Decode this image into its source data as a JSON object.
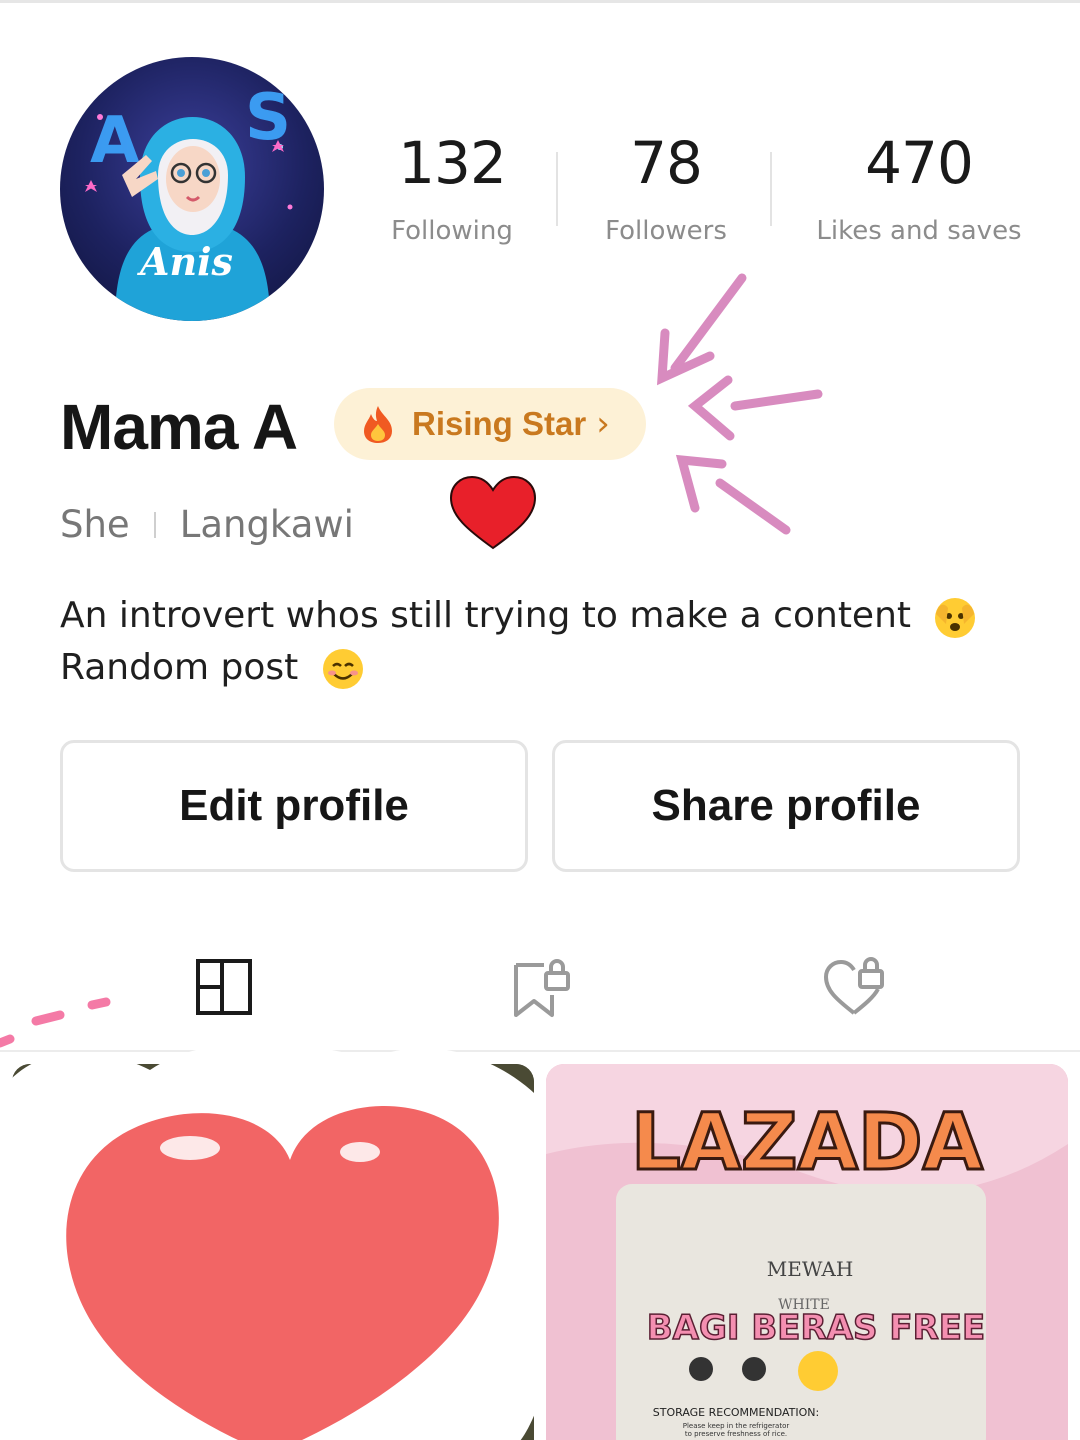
{
  "profile": {
    "name": "Mama A",
    "badge": {
      "label": "Rising Star",
      "icon": "fire-icon",
      "chevron": "›"
    },
    "pronoun": "She",
    "location": "Langkawi",
    "bio_line1": "An introvert whos still trying to make a content",
    "bio_line2": "Random post",
    "avatar_text": "Anis"
  },
  "stats": {
    "following": {
      "value": "132",
      "label": "Following"
    },
    "followers": {
      "value": "78",
      "label": "Followers"
    },
    "likes": {
      "value": "470",
      "label": "Likes and saves"
    }
  },
  "actions": {
    "edit_label": "Edit profile",
    "share_label": "Share profile"
  },
  "tabs": [
    {
      "icon": "grid-layout-icon",
      "active": true
    },
    {
      "icon": "locked-bookmark-icon",
      "active": false
    },
    {
      "icon": "locked-heart-icon",
      "active": false
    }
  ],
  "posts": [
    {
      "thumbnail": "red-heart-sticker"
    },
    {
      "title": "LAZADA",
      "brand": "MEWAH",
      "variety": "WHITE",
      "caption": "BAGI BERAS FREE",
      "storage_title": "STORAGE RECOMMENDATION:",
      "storage_line1": "Please keep in the refrigerator",
      "storage_line2": "to preserve freshness of rice."
    }
  ],
  "colors": {
    "badge_bg": "#fdf1d6",
    "badge_text": "#c9791f",
    "annotation_pink": "#d88bbf",
    "heart_red": "#e8202a"
  }
}
